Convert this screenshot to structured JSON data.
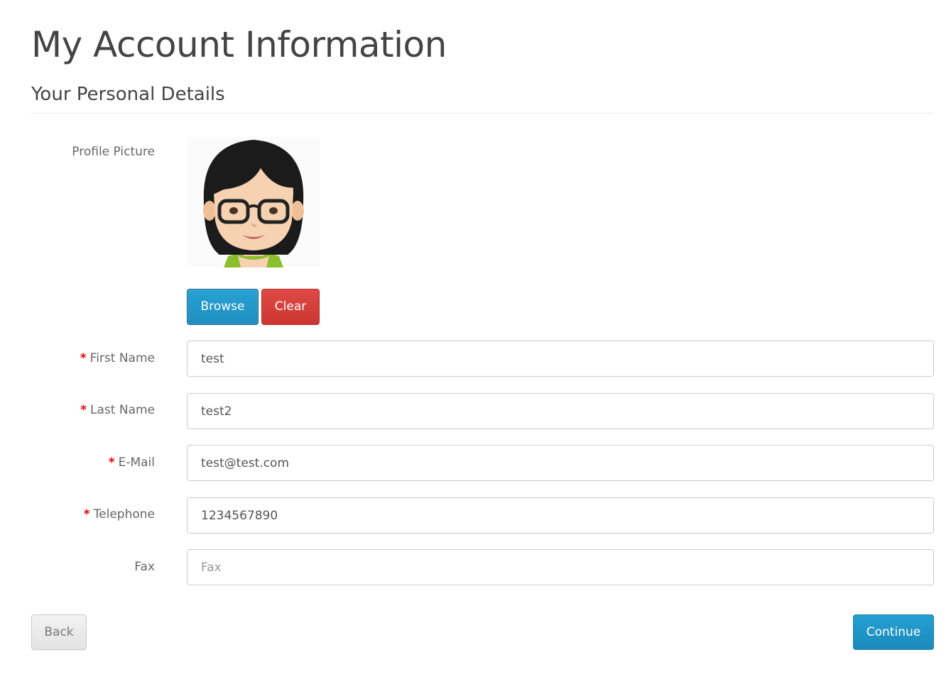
{
  "page": {
    "title": "My Account Information"
  },
  "section": {
    "title": "Your Personal Details"
  },
  "profile_picture": {
    "label": "Profile Picture",
    "browse_label": "Browse",
    "clear_label": "Clear"
  },
  "form": {
    "required_marker": "*",
    "first_name": {
      "label": "First Name",
      "value": "test",
      "placeholder": "First Name"
    },
    "last_name": {
      "label": "Last Name",
      "value": "test2",
      "placeholder": "Last Name"
    },
    "email": {
      "label": "E-Mail",
      "value": "test@test.com",
      "placeholder": "E-Mail"
    },
    "telephone": {
      "label": "Telephone",
      "value": "1234567890",
      "placeholder": "Telephone"
    },
    "fax": {
      "label": "Fax",
      "value": "",
      "placeholder": "Fax"
    }
  },
  "actions": {
    "back_label": "Back",
    "continue_label": "Continue"
  },
  "colors": {
    "primary": "#2196c9",
    "danger": "#d9433f",
    "required": "#f00000"
  }
}
